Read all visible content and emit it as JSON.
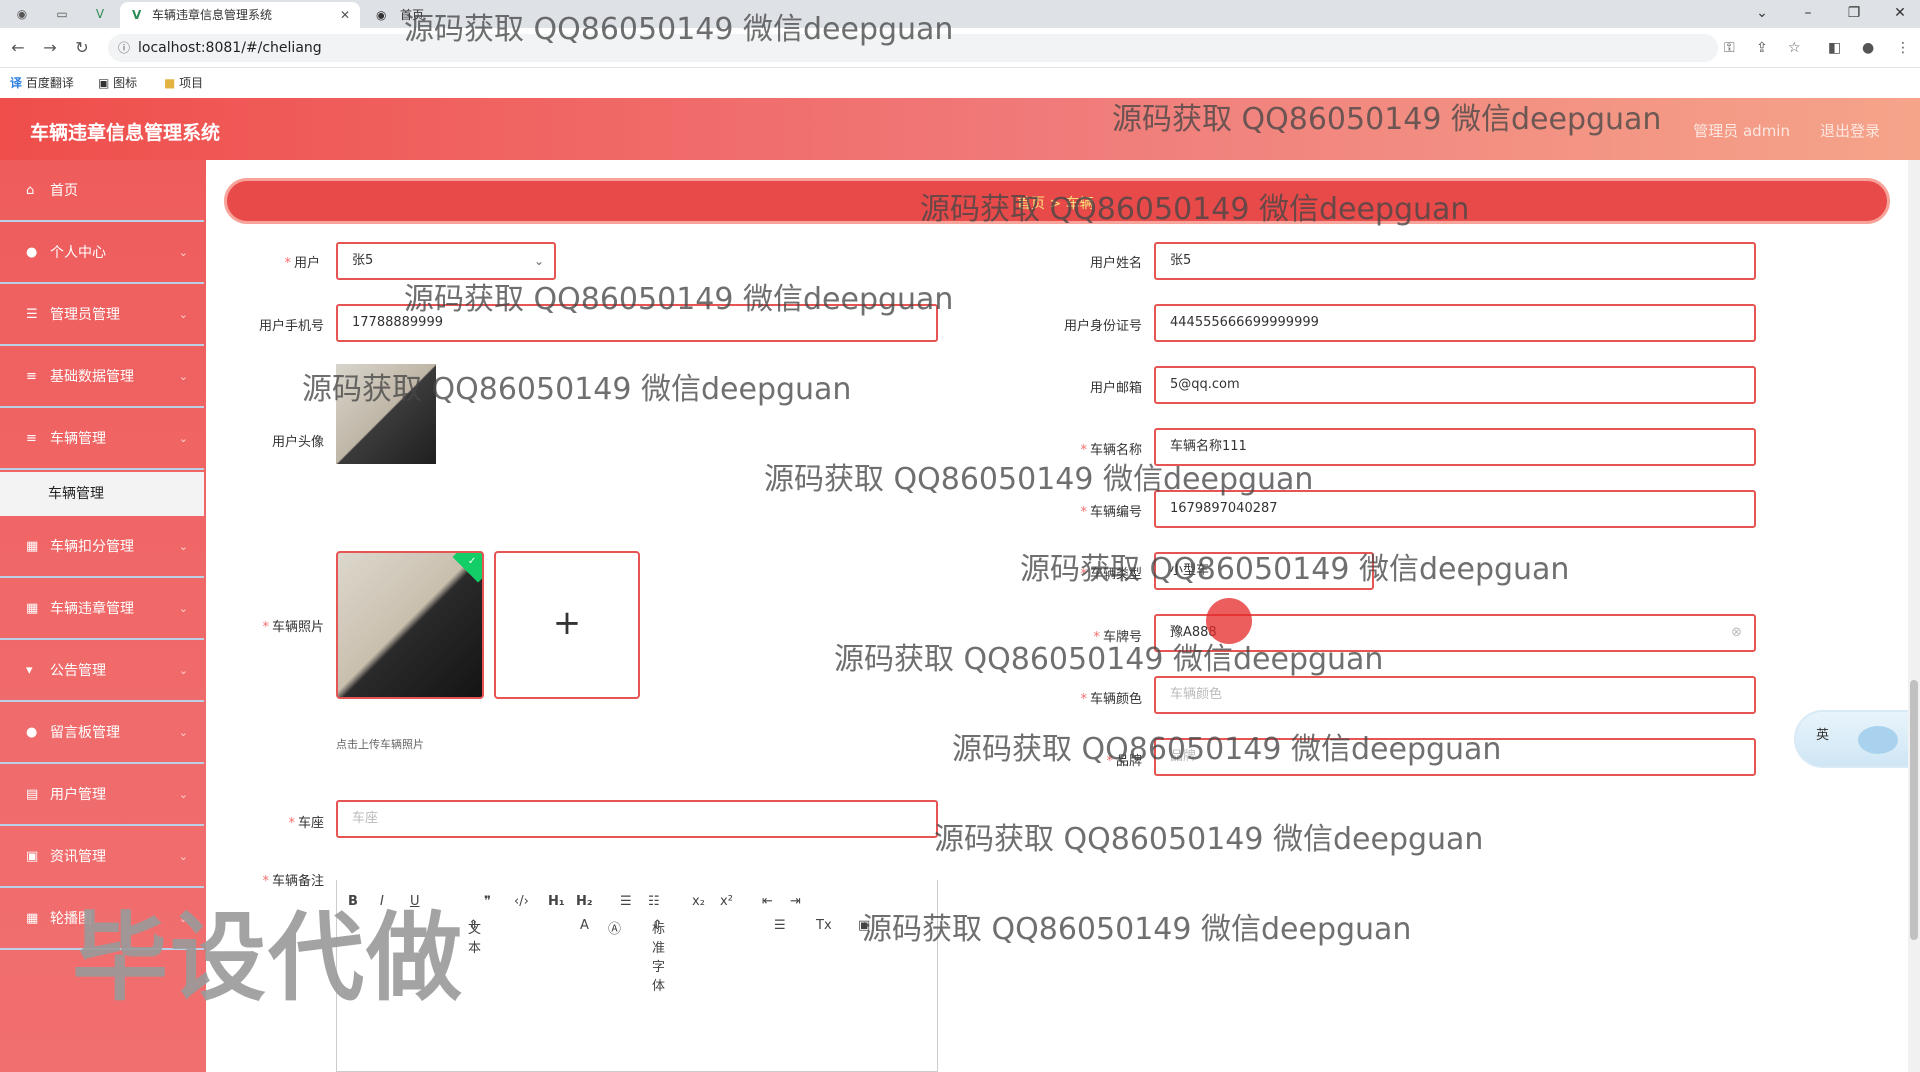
{
  "browser": {
    "active_tab_title": "车辆违章信息管理系统",
    "second_tab_title": "首页",
    "url": "localhost:8081/#/cheliang",
    "bookmarks": [
      "百度翻译",
      "图标",
      "项目"
    ]
  },
  "header": {
    "title": "车辆违章信息管理系统",
    "admin": "管理员 admin",
    "logout": "退出登录"
  },
  "sidebar": {
    "items": [
      {
        "label": "首页",
        "icon": "home-icon"
      },
      {
        "label": "个人中心",
        "icon": "user-icon"
      },
      {
        "label": "管理员管理",
        "icon": "sliders-icon"
      },
      {
        "label": "基础数据管理",
        "icon": "menu-icon"
      },
      {
        "label": "车辆管理",
        "icon": "menu-icon"
      },
      {
        "label": "车辆扣分管理",
        "icon": "grid-icon"
      },
      {
        "label": "车辆违章管理",
        "icon": "grid-icon"
      },
      {
        "label": "公告管理",
        "icon": "bulletin-icon"
      },
      {
        "label": "留言板管理",
        "icon": "user-icon"
      },
      {
        "label": "用户管理",
        "icon": "clipboard-icon"
      },
      {
        "label": "资讯管理",
        "icon": "image-icon"
      },
      {
        "label": "轮播图",
        "icon": "grid-icon"
      }
    ],
    "active_sub": "车辆管理"
  },
  "breadcrumb": "首页 > 车辆",
  "form": {
    "user_label": "用户",
    "user_value": "张5",
    "user_name_label": "用户姓名",
    "user_name_value": "张5",
    "phone_label": "用户手机号",
    "phone_value": "17788889999",
    "idcard_label": "用户身份证号",
    "idcard_value": "444555666699999999",
    "email_label": "用户邮箱",
    "email_value": "5@qq.com",
    "avatar_label": "用户头像",
    "car_name_label": "车辆名称",
    "car_name_value": "车辆名称111",
    "car_no_label": "车辆编号",
    "car_no_value": "1679897040287",
    "car_type_label": "车辆类型",
    "car_type_value": "小型车",
    "plate_label": "车牌号",
    "plate_value": "豫A888",
    "color_label": "车辆颜色",
    "color_placeholder": "车辆颜色",
    "brand_label": "品牌",
    "brand_placeholder": "品牌",
    "photo_label": "车辆照片",
    "photo_hint": "点击上传车辆照片",
    "seat_label": "车座",
    "seat_placeholder": "车座",
    "remark_label": "车辆备注",
    "editor_text_label": "文本",
    "editor_font_label": "标准字体"
  },
  "lang_widget": "英",
  "watermarks": {
    "text": "源码获取 QQ86050149 微信deepguan",
    "big": "毕设代做"
  }
}
